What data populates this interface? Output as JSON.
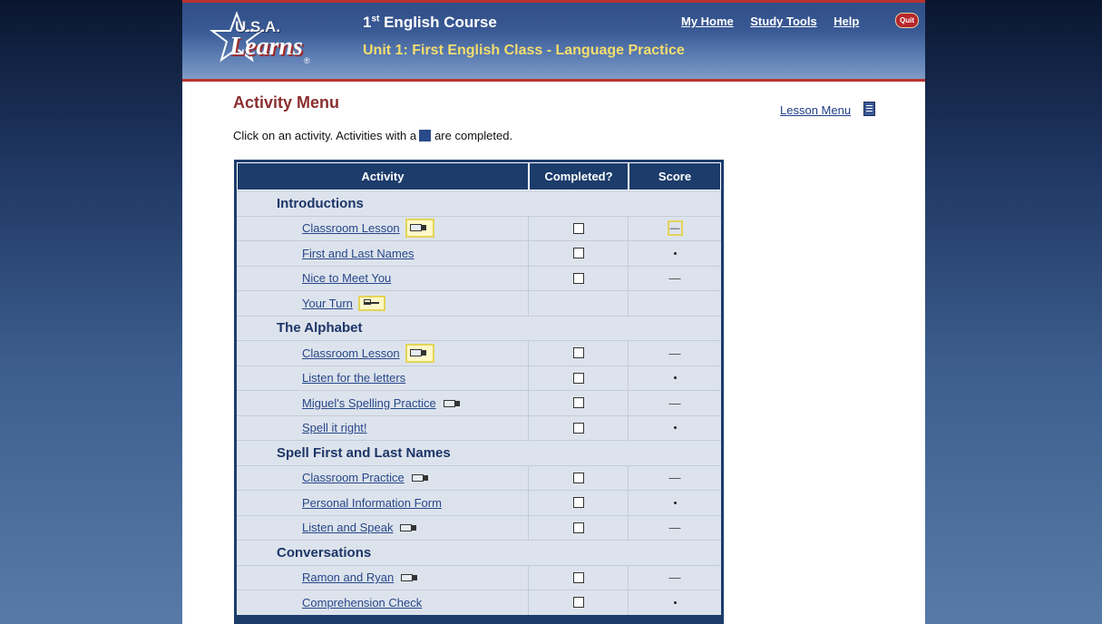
{
  "header": {
    "logo_usa": "U.S.A.",
    "logo_learns": "Learns",
    "logo_reg": "®",
    "course_title_prefix": "1",
    "course_title_sup": "st",
    "course_title_rest": " English Course",
    "unit_title": "Unit 1: First English Class - Language Practice",
    "nav": [
      "My Home",
      "Study Tools",
      "Help"
    ],
    "quit_label": "Quit"
  },
  "main": {
    "title": "Activity Menu",
    "lesson_menu_label": "Lesson Menu",
    "instructions_before": "Click on an activity. Activities with a",
    "instructions_after": "are completed."
  },
  "table": {
    "headers": [
      "Activity",
      "Completed?",
      "Score"
    ],
    "sections": [
      {
        "title": "Introductions",
        "items": [
          {
            "label": "Classroom Lesson",
            "icon": "video-camera-icon",
            "score": "—"
          },
          {
            "label": "First and Last Names",
            "icon": "",
            "score": "•"
          },
          {
            "label": "Nice to Meet You",
            "icon": "",
            "score": "—"
          },
          {
            "label": "Your Turn",
            "icon": "pointing-hand-icon",
            "score": ""
          }
        ]
      },
      {
        "title": "The Alphabet",
        "items": [
          {
            "label": "Classroom Lesson",
            "icon": "video-camera-icon",
            "score": "—"
          },
          {
            "label": "Listen for the letters",
            "icon": "",
            "score": "•"
          },
          {
            "label": "Miguel's Spelling Practice",
            "icon": "video-camera-icon",
            "score": "—"
          },
          {
            "label": "Spell it right!",
            "icon": "",
            "score": "•"
          }
        ]
      },
      {
        "title": "Spell First and Last Names",
        "items": [
          {
            "label": "Classroom Practice",
            "icon": "video-camera-icon",
            "score": "—"
          },
          {
            "label": "Personal Information Form",
            "icon": "",
            "score": "•"
          },
          {
            "label": "Listen and Speak",
            "icon": "video-camera-icon",
            "score": "—"
          }
        ]
      },
      {
        "title": "Conversations",
        "items": [
          {
            "label": "Ramon and Ryan",
            "icon": "video-camera-icon",
            "score": "—"
          },
          {
            "label": "Comprehension Check",
            "icon": "",
            "score": "•"
          }
        ]
      }
    ]
  },
  "colors": {
    "header_blue": "#3a5a95",
    "accent_red": "#b9332f",
    "unit_yellow": "#f3dd6e",
    "title_red": "#8b2f2f",
    "table_navy": "#1c3c6c",
    "row_bg": "#dde3ec"
  }
}
